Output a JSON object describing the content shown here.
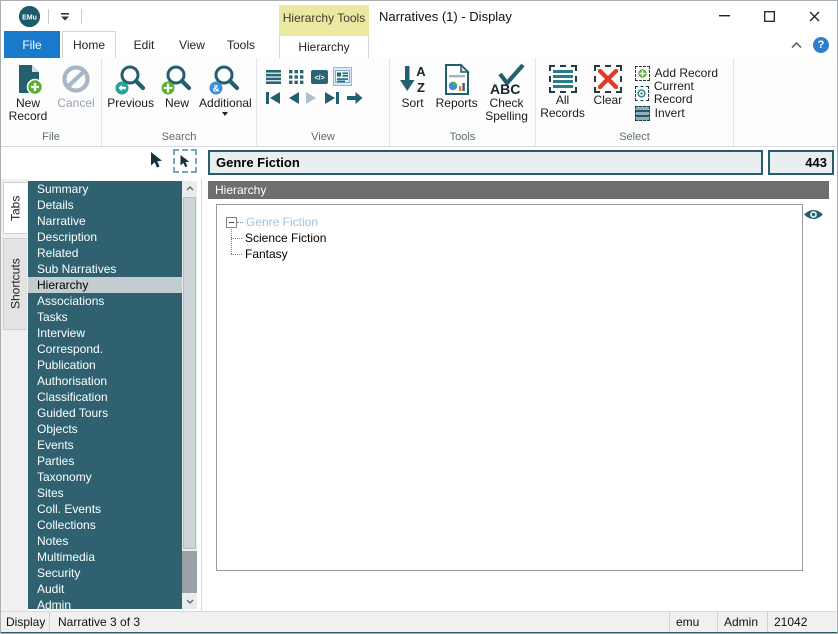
{
  "titlebar": {
    "contextual_group": "Hierarchy Tools",
    "title": "Narratives (1) - Display"
  },
  "ribbon": {
    "tabs": {
      "file": "File",
      "home": "Home",
      "edit": "Edit",
      "view": "View",
      "tools": "Tools",
      "hierarchy": "Hierarchy"
    },
    "groups": {
      "file": {
        "label": "File",
        "new_record": "New Record",
        "cancel": "Cancel"
      },
      "search": {
        "label": "Search",
        "previous": "Previous",
        "new": "New",
        "additional": "Additional"
      },
      "view": {
        "label": "View"
      },
      "tools": {
        "label": "Tools",
        "sort": "Sort",
        "reports": "Reports",
        "check_spelling": "Check Spelling"
      },
      "select": {
        "label": "Select",
        "all_records": "All Records",
        "clear": "Clear",
        "add_record": "Add Record",
        "current_record": "Current Record",
        "invert": "Invert"
      }
    }
  },
  "record_bar": {
    "title": "Genre Fiction",
    "count": "443"
  },
  "side_tabs": {
    "tabs": "Tabs",
    "shortcuts": "Shortcuts"
  },
  "sidebar": {
    "items": [
      {
        "label": "Summary"
      },
      {
        "label": "Details"
      },
      {
        "label": "Narrative"
      },
      {
        "label": "Description"
      },
      {
        "label": "Related"
      },
      {
        "label": "Sub Narratives"
      },
      {
        "label": "Hierarchy",
        "selected": true
      },
      {
        "label": "Associations"
      },
      {
        "label": "Tasks"
      },
      {
        "label": "Interview"
      },
      {
        "label": "Correspond."
      },
      {
        "label": "Publication"
      },
      {
        "label": "Authorisation"
      },
      {
        "label": "Classification"
      },
      {
        "label": "Guided Tours"
      },
      {
        "label": "Objects"
      },
      {
        "label": "Events"
      },
      {
        "label": "Parties"
      },
      {
        "label": "Taxonomy"
      },
      {
        "label": "Sites"
      },
      {
        "label": "Coll. Events"
      },
      {
        "label": "Collections"
      },
      {
        "label": "Notes"
      },
      {
        "label": "Multimedia"
      },
      {
        "label": "Security"
      },
      {
        "label": "Audit"
      },
      {
        "label": "Admin"
      }
    ]
  },
  "panel": {
    "header": "Hierarchy"
  },
  "tree": {
    "root": "Genre Fiction",
    "children": [
      "Science Fiction",
      "Fantasy"
    ]
  },
  "statusbar": {
    "left": [
      "Display",
      "Narrative 3 of 3"
    ],
    "right": [
      "emu",
      "Admin",
      "21042"
    ]
  },
  "icons": {
    "logo": "EMu",
    "help": "?",
    "ampersand": "&",
    "code": "</>",
    "sort_a": "A",
    "sort_z": "Z",
    "abc": "ABC"
  },
  "colors": {
    "sidebar_teal": "#2f6170",
    "icon_teal": "#255e6d",
    "tab_blue": "#1979ca",
    "contextual_yellow": "#ebe8a2",
    "record_border": "#2a5d6c",
    "selected_item": "#c3ccd0",
    "tree_current": "#9dc3e6",
    "red": "#df3a2e",
    "green": "#5ab031",
    "badge_blue": "#3e8ed8",
    "panel_header_gray": "#6e6e6e"
  }
}
